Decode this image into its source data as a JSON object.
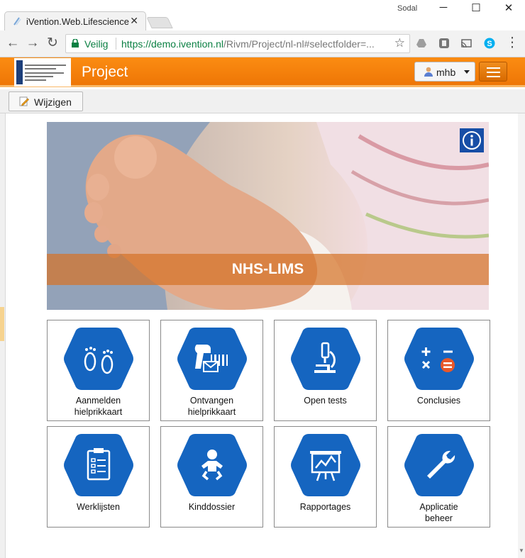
{
  "browser": {
    "tab_title": "iVention.Web.Lifescience",
    "tab_close": "✕",
    "window_user": "Sodal",
    "window_controls": {
      "minimize": "─",
      "maximize": "☐",
      "close": "✕"
    },
    "nav": {
      "back": "←",
      "forward": "→",
      "reload": "↻"
    },
    "secure_label": "Veilig",
    "url_host": "https://demo.ivention.nl",
    "url_path": "/Rivm/Project/nl-nl#selectfolder=...",
    "star": "☆",
    "menu_dots": "⋮"
  },
  "app": {
    "title": "Project",
    "user": "mhb",
    "accent_color": "#f5820b",
    "tile_icon_color": "#1565c0"
  },
  "toolbar": {
    "edit_label": "Wijzigen"
  },
  "banner": {
    "title": "NHS-LIMS",
    "info_icon": "i"
  },
  "tiles": [
    {
      "label": "Aanmelden hielprikkaart",
      "line1": "Aanmelden",
      "line2": "hielprikkaart",
      "icon": "footprints-icon"
    },
    {
      "label": "Ontvangen hielprikkaart",
      "line1": "Ontvangen",
      "line2": "hielprikkaart",
      "icon": "barcode-scanner-icon"
    },
    {
      "label": "Open tests",
      "line1": "Open tests",
      "line2": "",
      "icon": "microscope-icon"
    },
    {
      "label": "Conclusies",
      "line1": "Conclusies",
      "line2": "",
      "icon": "calculator-icon"
    },
    {
      "label": "Werklijsten",
      "line1": "Werklijsten",
      "line2": "",
      "icon": "clipboard-list-icon"
    },
    {
      "label": "Kinddossier",
      "line1": "Kinddossier",
      "line2": "",
      "icon": "baby-icon"
    },
    {
      "label": "Rapportages",
      "line1": "Rapportages",
      "line2": "",
      "icon": "presentation-chart-icon"
    },
    {
      "label": "Applicatie beheer",
      "line1": "Applicatie",
      "line2": "beheer",
      "icon": "wrench-icon"
    }
  ]
}
